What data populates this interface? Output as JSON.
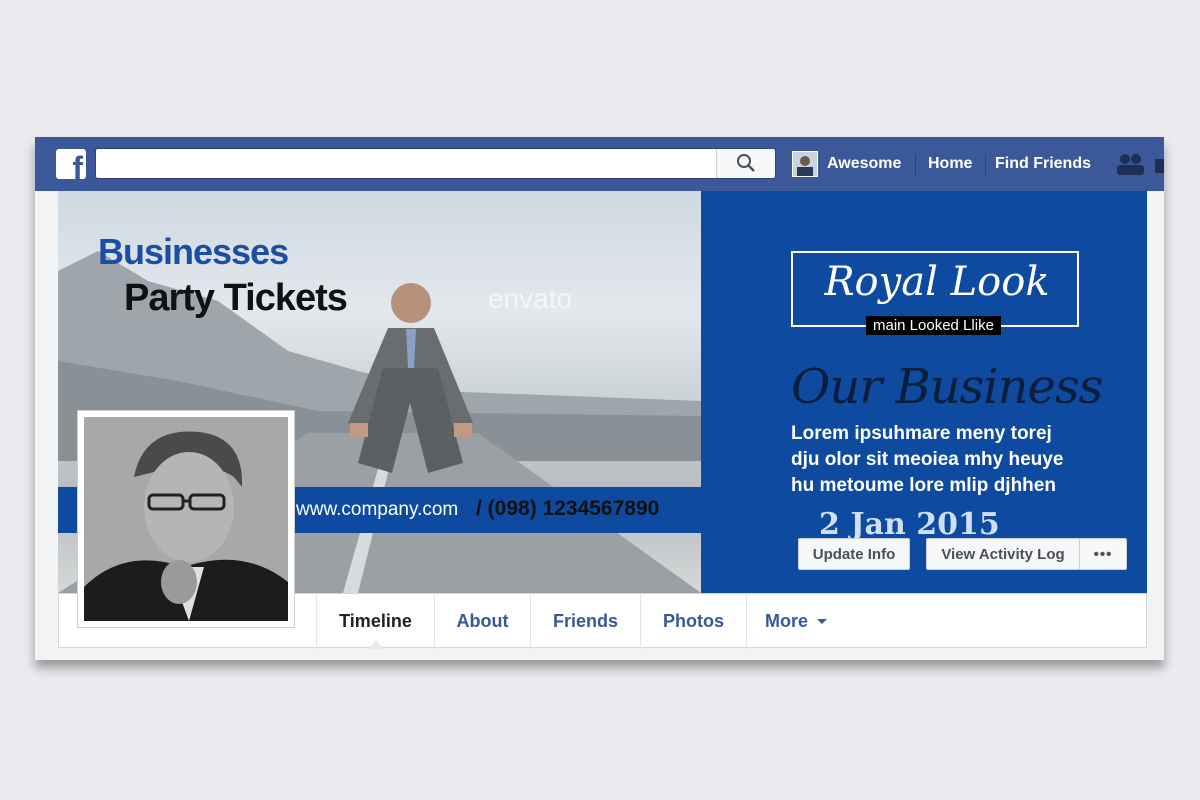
{
  "topbar": {
    "logo": "f",
    "search_placeholder": "",
    "user_name": "Awesome",
    "nav": [
      "Home",
      "Find Friends"
    ]
  },
  "cover": {
    "headline1": "Businesses",
    "headline2": "Party Tickets",
    "watermark": "envato",
    "website": "www.company.com",
    "phone": "/ (098) 1234567890",
    "royal_title": "Royal Look",
    "royal_sub": "main Looked Llike",
    "our_business": "Our Business",
    "lorem_lines": [
      "Lorem ipsuhmare meny torej",
      "dju olor sit meoiea mhy heuye",
      "hu metoume lore mlip djhhen"
    ],
    "date": "2 Jan 2015"
  },
  "actions": {
    "update_info": "Update Info",
    "activity_log": "View Activity Log",
    "more_dots": "•••"
  },
  "tabs": [
    {
      "label": "Timeline"
    },
    {
      "label": "About"
    },
    {
      "label": "Friends"
    },
    {
      "label": "Photos"
    },
    {
      "label": "More"
    }
  ],
  "colors": {
    "facebook_blue": "#3b5998",
    "cover_blue": "#0e4aa0"
  }
}
